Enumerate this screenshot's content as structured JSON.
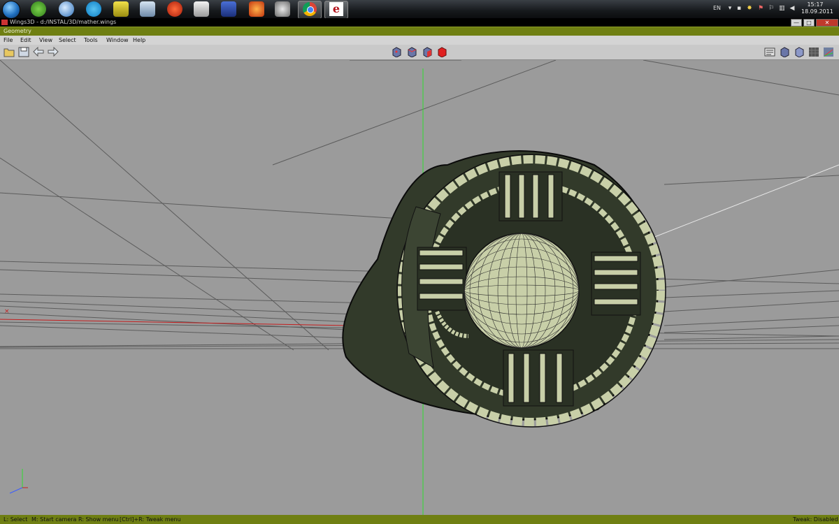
{
  "taskbar": {
    "tray": {
      "language": "EN",
      "time": "15:17",
      "date": "18.09.2011"
    },
    "pinned_icons": [
      "utorrent-icon",
      "google-earth-icon",
      "skype-icon",
      "gamepad-icon",
      "tool-icon",
      "ccleaner-icon",
      "speaker-icon",
      "floppy-icon",
      "firefox-icon",
      "skull-icon",
      "chrome-icon",
      "erlang-icon"
    ]
  },
  "window": {
    "title": "Wings3D - d:/INSTAL/3D/mather.wings",
    "controls": [
      "—",
      "□",
      "✕"
    ]
  },
  "geometry_title": "Geometry",
  "menu": [
    "File",
    "Edit",
    "View",
    "Select",
    "Tools",
    "Window",
    "Help"
  ],
  "status": {
    "select": "L: Select",
    "camera": "M: Start camera",
    "menu": "R: Show menu",
    "tweak_menu": "[Ctrl]+R: Tweak menu",
    "tweak_state": "Tweak: Disabled"
  },
  "colors": {
    "accent": "#6f7f12",
    "viewport": "#9b9b9b",
    "model_dark": "#323a2a",
    "model_light": "#c8cfa8"
  }
}
